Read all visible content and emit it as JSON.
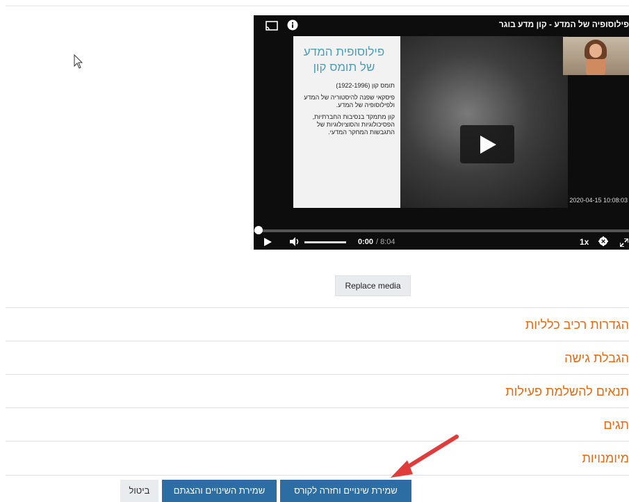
{
  "video": {
    "title": "פילוסופיה של המדע - קון מדע בוגר",
    "slide": {
      "title_line1": "פילוסופית המדע",
      "title_line2": "של תומס קון",
      "body_line1": "תומס קון (1922-1996)",
      "body_para2": "פיסקאי שפנה להיסטוריה של המדע ולפילוסופיה של המדע.",
      "body_para3": "קון מתמקד בנסיבות החברתיות, הפסיכולוגיות והסוציולוגיות של התגבשות המחקר המדעי."
    },
    "timestamp": "2020-04-15 10:08:03",
    "current_time": "0:00",
    "duration": "/ 8:04",
    "speed": "1x",
    "progress": 0
  },
  "replace_media_label": "Replace media",
  "sections": [
    "הגדרות רכיב כלליות",
    "הגבלת גישה",
    "תנאים להשלמת פעילות",
    "תגים",
    "מיומנויות"
  ],
  "buttons": {
    "save_return": "שמירת שינויים וחזרה לקורס",
    "save_display": "שמירת השינויים והצגתם",
    "cancel": "ביטול"
  },
  "colors": {
    "accent": "#e8690f",
    "primary": "#2c6da4",
    "annotation_arrow": "#e03c3c"
  }
}
